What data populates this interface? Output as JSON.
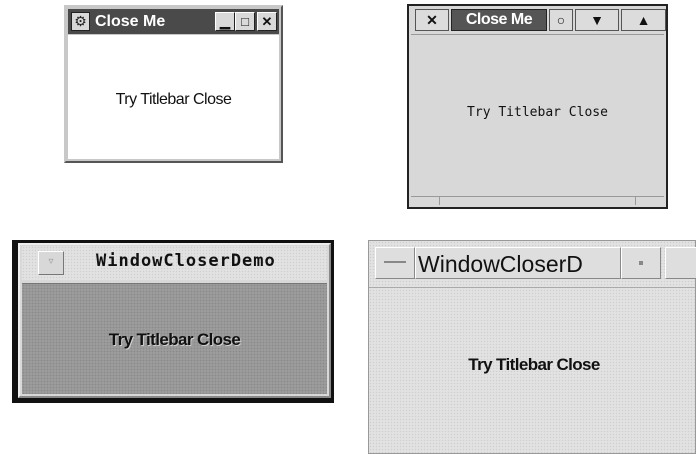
{
  "windows": {
    "a": {
      "title": "Close Me",
      "icon": "app-icon",
      "minimize_glyph": "▁",
      "maximize_glyph": "□",
      "close_glyph": "✕",
      "label": "Try Titlebar Close"
    },
    "b": {
      "close_glyph": "✕",
      "title": "Close Me",
      "iconify_glyph": "○",
      "lower_glyph": "▼",
      "raise_glyph": "▲",
      "label": "Try Titlebar Close"
    },
    "c": {
      "menu_glyph": "▿",
      "title": "WindowCloserDemo",
      "label": "Try Titlebar Close"
    },
    "d": {
      "title": "WindowCloserD",
      "label": "Try Titlebar Close"
    }
  },
  "colors": {
    "titlebar_dark": "#4a4a4a",
    "content_gray": "#9c9c9c",
    "content_light": "#e2e2e2"
  }
}
